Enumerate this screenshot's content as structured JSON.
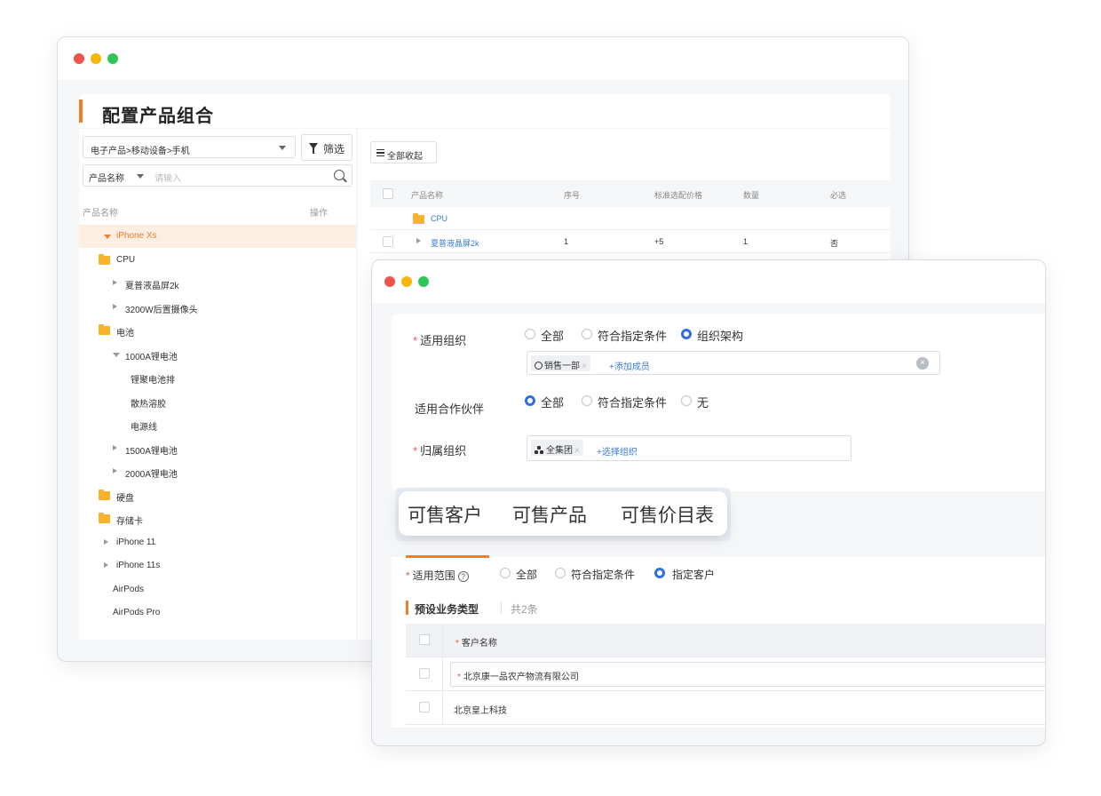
{
  "back_window": {
    "title": "配置产品组合",
    "category_select": "电子产品>移动设备>手机",
    "filter_label": "筛选",
    "search_key": "产品名称",
    "search_placeholder": "请输入",
    "tree_headers": {
      "name": "产品名称",
      "action": "操作"
    },
    "tree": [
      {
        "label": "iPhone Xs",
        "kind": "expanded",
        "level": 0,
        "selected": true
      },
      {
        "label": "CPU",
        "kind": "folder",
        "level": 0
      },
      {
        "label": "夏普液晶屏2k",
        "kind": "collapsed",
        "level": 1
      },
      {
        "label": "3200W后置摄像头",
        "kind": "collapsed",
        "level": 1
      },
      {
        "label": "电池",
        "kind": "folder",
        "level": 0
      },
      {
        "label": "1000A锂电池",
        "kind": "expanded",
        "level": 1
      },
      {
        "label": "锂聚电池排",
        "kind": "leaf",
        "level": 2
      },
      {
        "label": "散热溶胶",
        "kind": "leaf",
        "level": 2
      },
      {
        "label": "电源线",
        "kind": "leaf",
        "level": 2
      },
      {
        "label": "1500A锂电池",
        "kind": "collapsed",
        "level": 1
      },
      {
        "label": "2000A锂电池",
        "kind": "collapsed",
        "level": 1
      },
      {
        "label": "硬盘",
        "kind": "folder",
        "level": 0
      },
      {
        "label": "存储卡",
        "kind": "folder",
        "level": 0
      },
      {
        "label": "iPhone 11",
        "kind": "collapsed",
        "level": 0
      },
      {
        "label": "iPhone 11s",
        "kind": "collapsed",
        "level": 0
      },
      {
        "label": "AirPods",
        "kind": "leaf",
        "level": 0
      },
      {
        "label": "AirPods Pro",
        "kind": "leaf",
        "level": 0
      }
    ],
    "collapse_all_label": "全部收起",
    "table_headers": [
      "产品名称",
      "序号",
      "标准选配价格",
      "数量",
      "必选"
    ],
    "table_group": "CPU",
    "table_rows": [
      {
        "name": "夏普液晶屏2k",
        "seq": "1",
        "price": "+5",
        "qty": "1",
        "required": "否"
      }
    ]
  },
  "front_window": {
    "org_field": {
      "label": "适用组织",
      "options": [
        "全部",
        "符合指定条件",
        "组织架构"
      ],
      "selected": 2,
      "tag": "销售一部",
      "add_link": "+添加成员"
    },
    "partner_field": {
      "label": "适用合作伙伴",
      "options": [
        "全部",
        "符合指定条件",
        "无"
      ],
      "selected": 0
    },
    "belong_field": {
      "label": "归属组织",
      "tag": "全集团",
      "add_link": "+选择组织"
    },
    "tabs": [
      "可售客户",
      "可售产品",
      "可售价目表"
    ],
    "scope_field": {
      "label": "适用范围",
      "help": "?",
      "options": [
        "全部",
        "符合指定条件",
        "指定客户"
      ],
      "selected": 2
    },
    "section": {
      "title": "预设业务类型",
      "count": "共2条"
    },
    "customer_table": {
      "header": "客户名称",
      "rows": [
        "北京康一品农产物流有限公司",
        "北京皇上科技"
      ]
    }
  },
  "colors": {
    "accent": "#f07c2e",
    "primary": "#2f6fe4",
    "link": "#3a7bd5"
  }
}
